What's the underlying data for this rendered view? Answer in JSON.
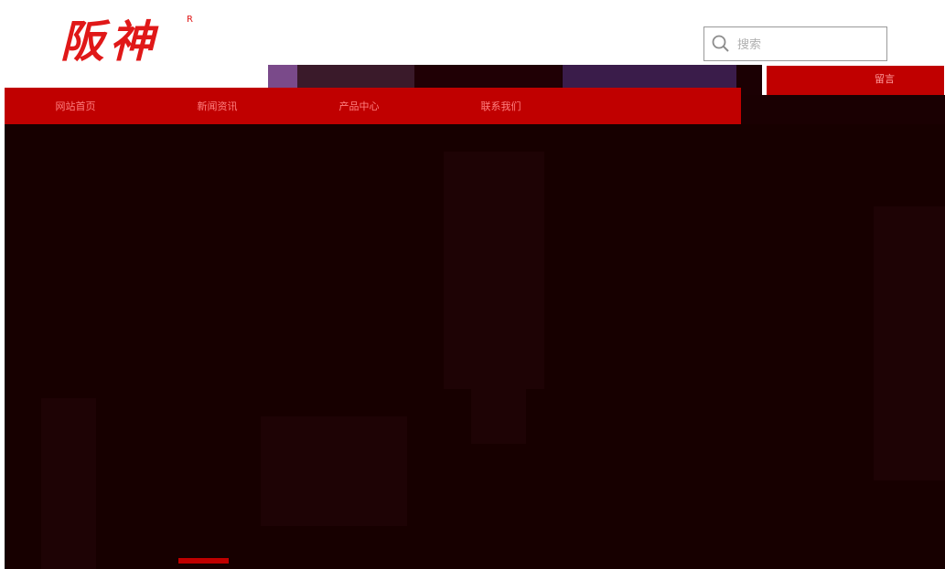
{
  "header": {
    "logo_text": "阪神",
    "logo_mark": "R"
  },
  "search": {
    "placeholder": "搜索",
    "icon": "search-icon"
  },
  "nav": {
    "items": [
      {
        "label": "网站首页"
      },
      {
        "label": "新闻资讯"
      },
      {
        "label": "产品中心"
      },
      {
        "label": "联系我们"
      }
    ]
  },
  "side_button": {
    "label": "留言"
  },
  "colors": {
    "brand_red": "#c00000",
    "logo_red": "#e01818",
    "hero_dark": "#170000"
  }
}
